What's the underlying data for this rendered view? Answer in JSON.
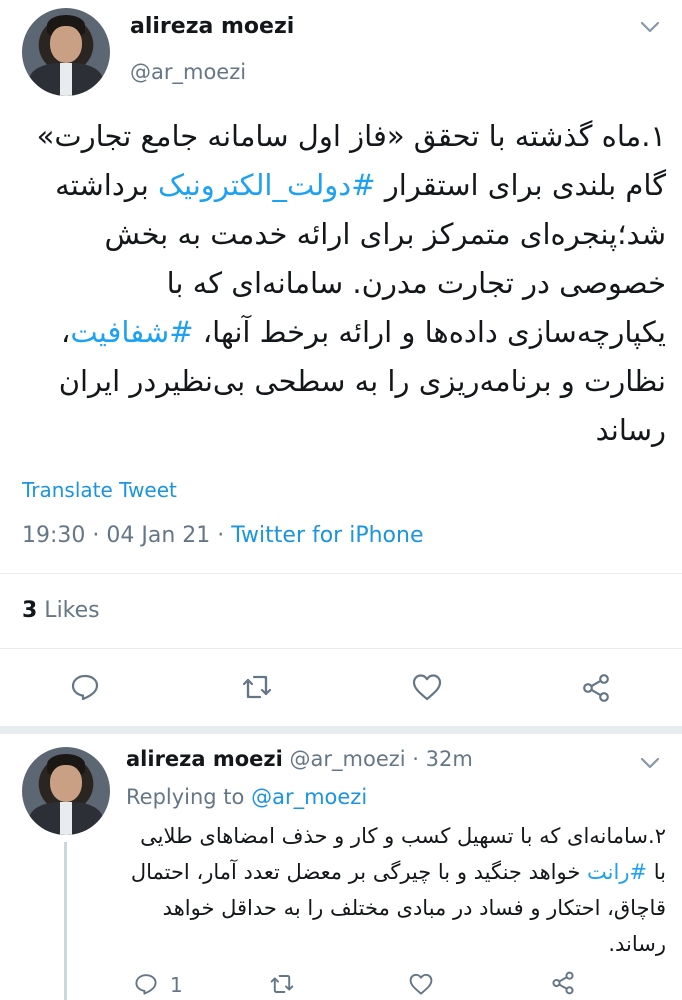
{
  "tweet1": {
    "name": "alireza moezi",
    "handle": "@ar_moezi",
    "text_parts": {
      "p1": "۱.ماه گذشته با تحقق «فاز اول سامانه جامع تجارت» گام بلندی برای استقرار ",
      "tag1": "#دولت_الکترونیک",
      "p2": " برداشته شد؛پنجره‌ای متمرکز برای ارائه خدمت به بخش خصوصی در تجارت مدرن. سامانه‌ای که با یکپارچه‌سازی داده‌ها و ارائه برخط آنها، ",
      "tag2": "#شفافیت",
      "p3": "، نظارت و برنامه‌ریزی را به سطحی بی‌نظیردر ایران رساند"
    },
    "translate": "Translate Tweet",
    "time": "19:30 · 04 Jan 21 · ",
    "source": "Twitter for iPhone",
    "likes_count": "3",
    "likes_label": " Likes"
  },
  "tweet2": {
    "name": "alireza moezi",
    "meta": "@ar_moezi · 32m",
    "replying_prefix": "Replying to ",
    "replying_handle": "@ar_moezi",
    "text_parts": {
      "p1": "۲.سامانه‌ای که با تسهیل کسب و کار و حذف امضاهای طلایی با ",
      "tag1": "#رانت",
      "p2": " خواهد جنگید و با چیرگی بر معضل تعدد آمار، احتمال قاچاق، احتکار و فساد در مبادی مختلف را به حداقل خواهد رساند."
    },
    "reply_count": "1"
  },
  "colors": {
    "accent": "#1da1f2",
    "muted": "#657786",
    "divider": "#e6ecf0"
  }
}
